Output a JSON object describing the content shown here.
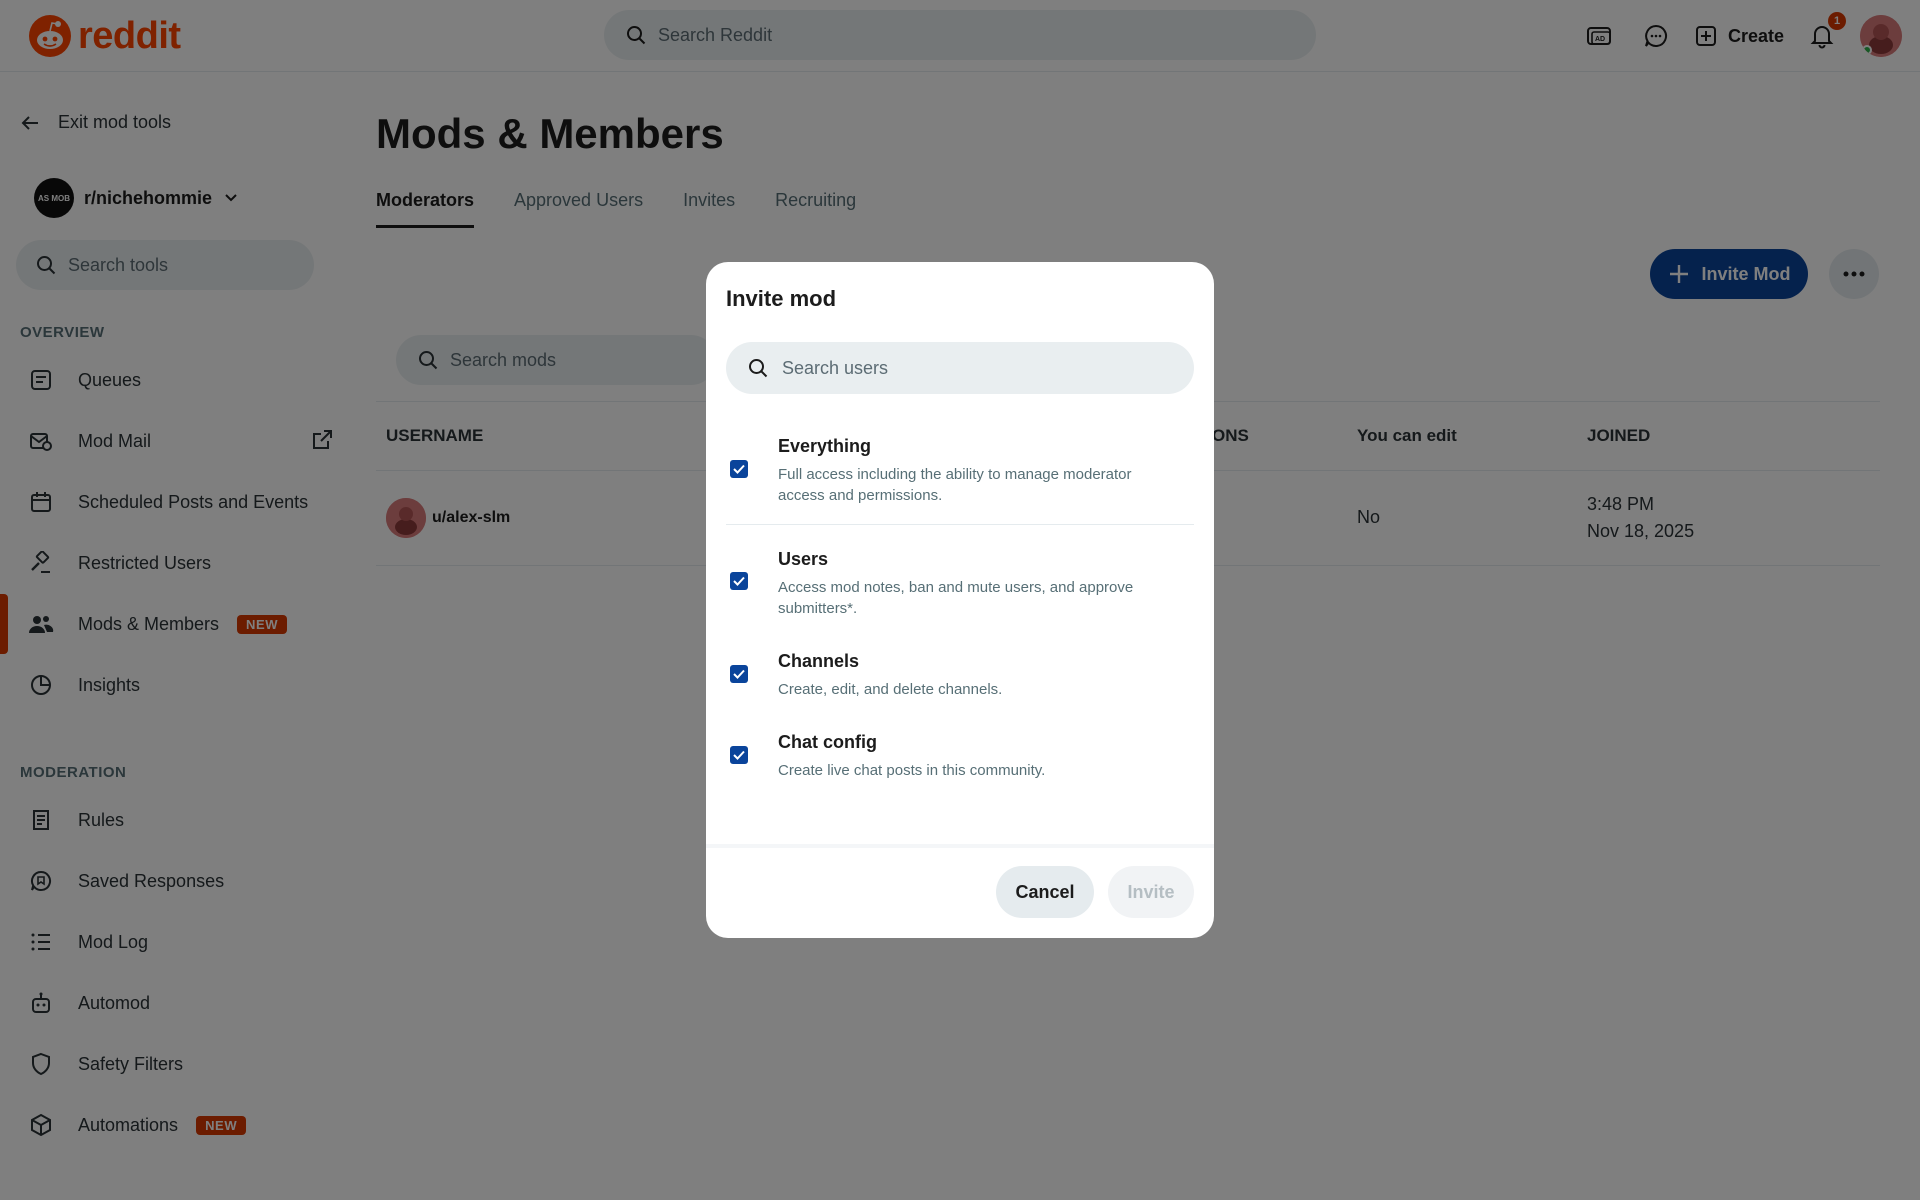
{
  "header": {
    "logo_text": "reddit",
    "search_placeholder": "Search Reddit",
    "create_label": "Create",
    "notification_count": "1",
    "brand_color": "#ff4500"
  },
  "sidebar": {
    "exit_label": "Exit mod tools",
    "community_name": "r/nichehommie",
    "community_avatar_text": "AS MOB",
    "search_placeholder": "Search tools",
    "overview_label": "OVERVIEW",
    "overview_items": [
      {
        "label": "Queues",
        "icon": "queue-icon"
      },
      {
        "label": "Mod Mail",
        "icon": "mail-icon"
      },
      {
        "label": "Scheduled Posts and Events",
        "icon": "calendar-icon"
      },
      {
        "label": "Restricted Users",
        "icon": "hammer-icon"
      },
      {
        "label": "Mods & Members",
        "icon": "members-icon",
        "badge": "NEW",
        "active": true
      },
      {
        "label": "Insights",
        "icon": "chart-icon"
      }
    ],
    "moderation_label": "MODERATION",
    "moderation_items": [
      {
        "label": "Rules",
        "icon": "rules-icon"
      },
      {
        "label": "Saved Responses",
        "icon": "saved-responses-icon"
      },
      {
        "label": "Mod Log",
        "icon": "list-icon"
      },
      {
        "label": "Automod",
        "icon": "robot-icon"
      },
      {
        "label": "Safety Filters",
        "icon": "shield-icon"
      },
      {
        "label": "Automations",
        "icon": "cube-icon",
        "badge": "NEW"
      }
    ]
  },
  "main": {
    "title": "Mods & Members",
    "tabs": [
      "Moderators",
      "Approved Users",
      "Invites",
      "Recruiting"
    ],
    "active_tab": "Moderators",
    "invite_mod_label": "Invite Mod",
    "search_placeholder": "Search mods",
    "table": {
      "columns": [
        "USERNAME",
        "ONS",
        "You can edit",
        "JOINED"
      ],
      "rows": [
        {
          "username": "u/alex-slm",
          "can_edit": "No",
          "joined_time": "3:48 PM",
          "joined_date": "Nov 18, 2025"
        }
      ]
    }
  },
  "modal": {
    "title": "Invite mod",
    "search_placeholder": "Search users",
    "permissions": [
      {
        "title": "Everything",
        "description": "Full access including the ability to manage moderator access and permissions.",
        "checked": true
      },
      {
        "title": "Users",
        "description": "Access mod notes, ban and mute users, and approve submitters*.",
        "checked": true
      },
      {
        "title": "Channels",
        "description": "Create, edit, and delete channels.",
        "checked": true
      },
      {
        "title": "Chat config",
        "description": "Create live chat posts in this community.",
        "checked": true
      }
    ],
    "cancel_label": "Cancel",
    "invite_label": "Invite"
  }
}
